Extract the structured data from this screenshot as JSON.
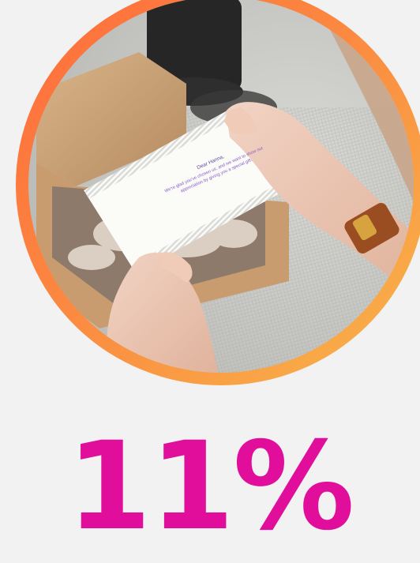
{
  "photo": {
    "card_greeting": "Dear Hanna,",
    "card_message": "We're glad you've chosen us, and we want to show our appreciation by giving you a special gift."
  },
  "stat": {
    "value": "11%"
  },
  "colors": {
    "stat_color": "#e10d9b",
    "ring_start": "#ff6a3c",
    "ring_end": "#f8b64a",
    "background": "#f2f2f2"
  }
}
